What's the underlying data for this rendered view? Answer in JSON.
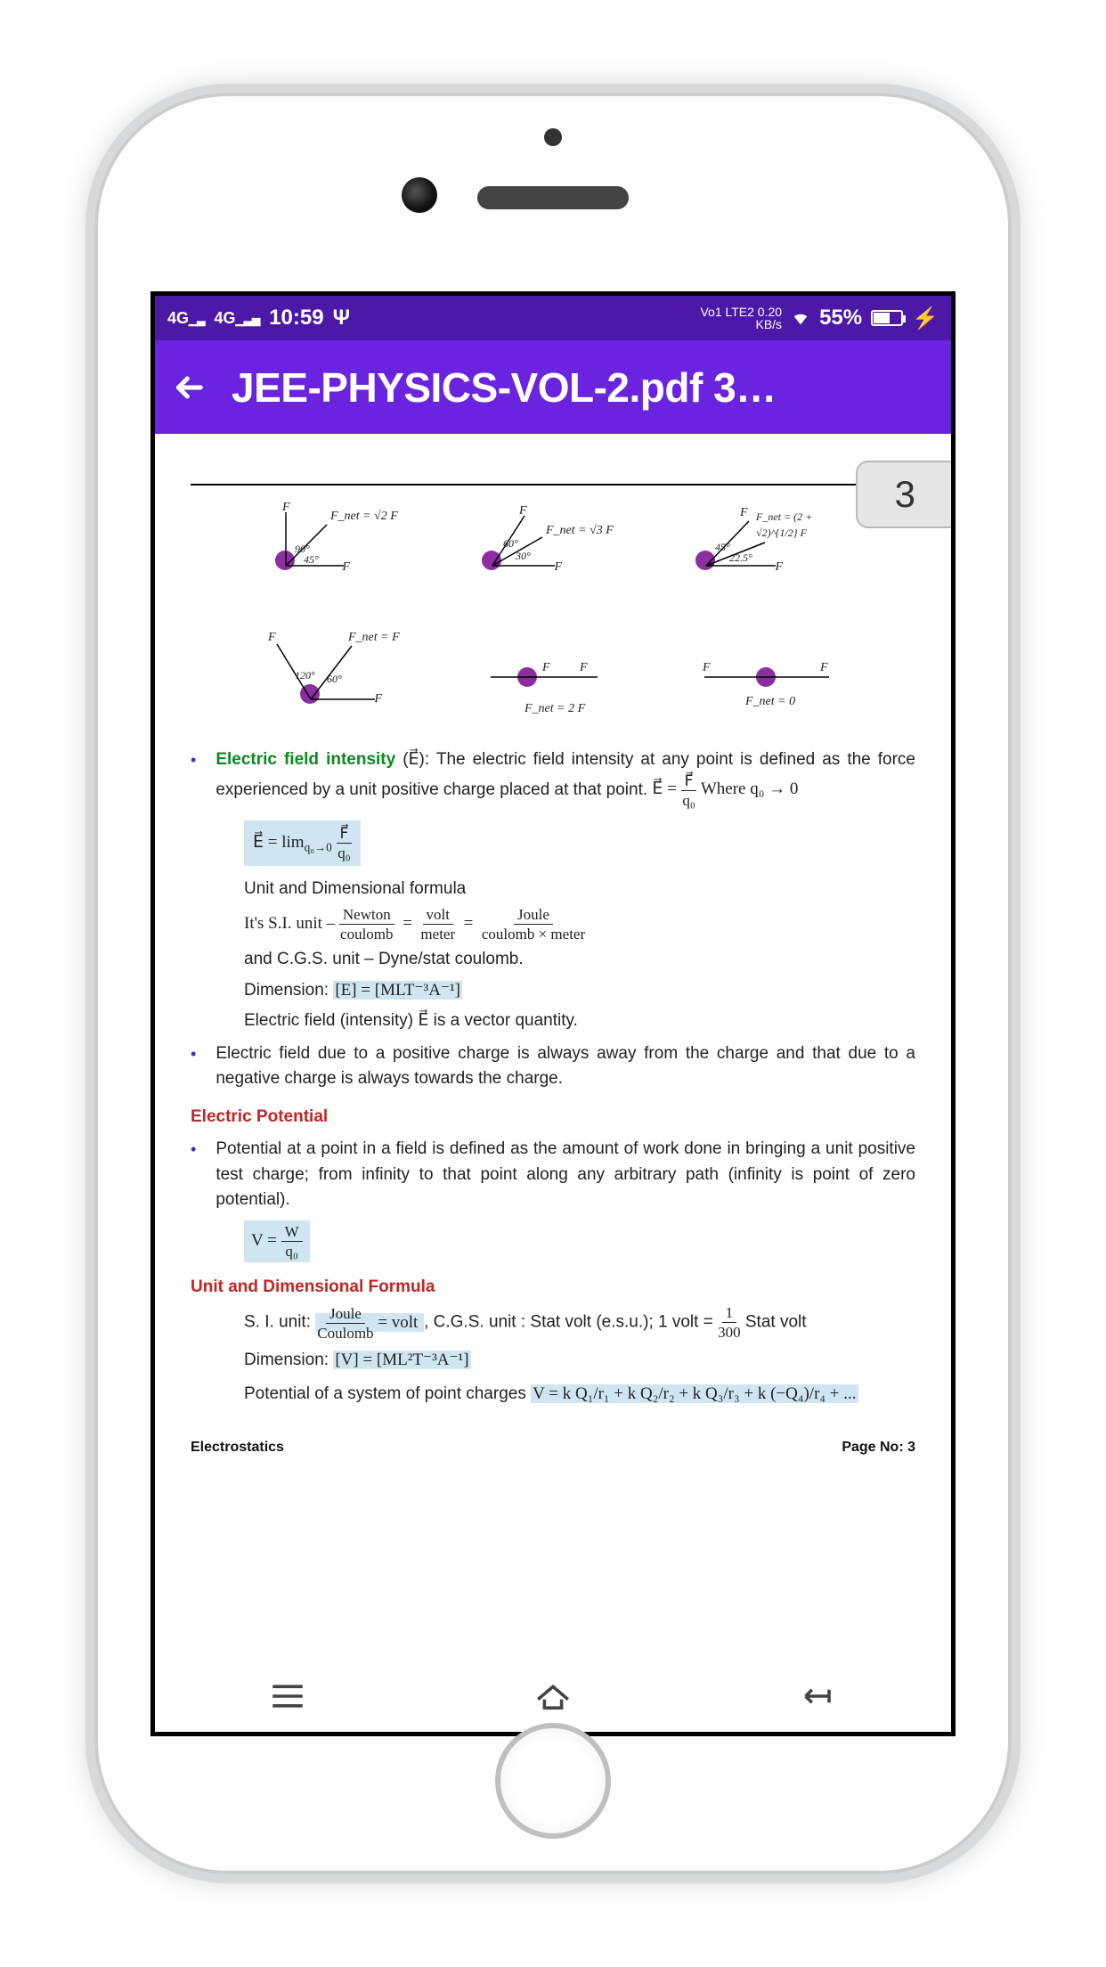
{
  "statusbar": {
    "net1": "4G",
    "net2": "4G",
    "time": "10:59",
    "data_top": "Vo1 LTE2 0.20",
    "data_bottom": "KB/s",
    "battery_pct": "55%"
  },
  "appbar": {
    "title": "JEE-PHYSICS-VOL-2.pdf 3…"
  },
  "page": {
    "chip": "3",
    "diagrams": {
      "force_symbol": "F",
      "fnet_sqrt2": "F_net = √2 F",
      "fnet_sqrt3": "F_net = √3 F",
      "fnet_2psqrt2": "F_net = (2 + √2)^{1/2} F",
      "fnet_f": "F_net = F",
      "fnet_2f": "F_net = 2 F",
      "fnet_0": "F_net = 0",
      "ang_90": "90°",
      "ang_45": "45°",
      "ang_60": "60°",
      "ang_30": "30°",
      "ang_225": "22.5°",
      "ang_120": "120°"
    },
    "efield": {
      "heading": "Electric field intensity",
      "heading_tail": " (E⃗): The electric field intensity at any point is defined as the force experienced by a unit positive charge placed at that point. ",
      "eq_main_words": "Where q₀ → 0",
      "eq_main_lhs": "E⃗ =",
      "eq_main_num": "F⃗",
      "eq_main_den": "q₀",
      "eq_lim_lhs": "E⃗ = lim",
      "eq_lim_sub": "q₀→0",
      "eq_lim_num": "F⃗",
      "eq_lim_den": "q₀",
      "unit_heading": "Unit and Dimensional formula",
      "si_label": "It's S.I. unit –",
      "si_a_num": "Newton",
      "si_a_den": "coulomb",
      "si_b_num": "volt",
      "si_b_den": "meter",
      "si_c_num": "Joule",
      "si_c_den": "coulomb × meter",
      "cgs_line": "and C.G.S. unit – Dyne/stat coulomb.",
      "dim_label": "Dimension: ",
      "dim_value": "[E] = [MLT⁻³A⁻¹]",
      "vector_line": "Electric field (intensity) E⃗ is a vector quantity.",
      "direction_line": "Electric field due to a positive charge is always away from the charge and that due to a negative charge is always towards the charge."
    },
    "potential": {
      "heading": "Electric Potential",
      "definition": "Potential at a point in a field is defined as the amount of work done in bringing a unit positive test charge; from infinity to that point along any arbitrary path (infinity is point of zero potential).",
      "eq_lhs": "V =",
      "eq_num": "W",
      "eq_den": "q₀"
    },
    "unit_pot": {
      "heading": "Unit and Dimensional Formula",
      "si_label": "S. I. unit: ",
      "si_num": "Joule",
      "si_den": "Coulomb",
      "si_eq": "= volt",
      "cgs_text": " , C.G.S. unit : Stat volt (e.s.u.); 1 volt =",
      "cgs_num": "1",
      "cgs_den": "300",
      "cgs_tail": " Stat volt",
      "dim_label": "Dimension: ",
      "dim_value": "[V] = [ML²T⁻³A⁻¹]",
      "sys_label": "Potential of a system of point charges ",
      "sys_eq": "V = k Q₁/r₁ + k Q₂/r₂ + k Q₃/r₃ + k (−Q₄)/r₄ + ..."
    },
    "footer": {
      "left": "Electrostatics",
      "right": "Page No: 3"
    }
  }
}
